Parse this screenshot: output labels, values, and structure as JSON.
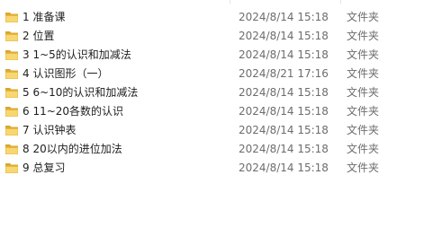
{
  "files": [
    {
      "name": "1 准备课",
      "date": "2024/8/14 15:18",
      "type": "文件夹",
      "icon": "folder-icon"
    },
    {
      "name": "2 位置",
      "date": "2024/8/14 15:18",
      "type": "文件夹",
      "icon": "folder-icon"
    },
    {
      "name": "3 1~5的认识和加减法",
      "date": "2024/8/14 15:18",
      "type": "文件夹",
      "icon": "folder-icon"
    },
    {
      "name": "4 认识图形（一）",
      "date": "2024/8/21 17:16",
      "type": "文件夹",
      "icon": "folder-icon"
    },
    {
      "name": "5 6~10的认识和加减法",
      "date": "2024/8/14 15:18",
      "type": "文件夹",
      "icon": "folder-icon"
    },
    {
      "name": "6 11~20各数的认识",
      "date": "2024/8/14 15:18",
      "type": "文件夹",
      "icon": "folder-icon"
    },
    {
      "name": "7 认识钟表",
      "date": "2024/8/14 15:18",
      "type": "文件夹",
      "icon": "folder-icon"
    },
    {
      "name": "8 20以内的进位加法",
      "date": "2024/8/14 15:18",
      "type": "文件夹",
      "icon": "folder-icon"
    },
    {
      "name": "9 总复习",
      "date": "2024/8/14 15:18",
      "type": "文件夹",
      "icon": "folder-icon"
    }
  ],
  "colors": {
    "folder_body": "#e8b73a",
    "folder_front": "#f7d774",
    "folder_tab": "#d9a52e",
    "text_primary": "#1e1e1e",
    "text_secondary": "#6d6d6d"
  }
}
